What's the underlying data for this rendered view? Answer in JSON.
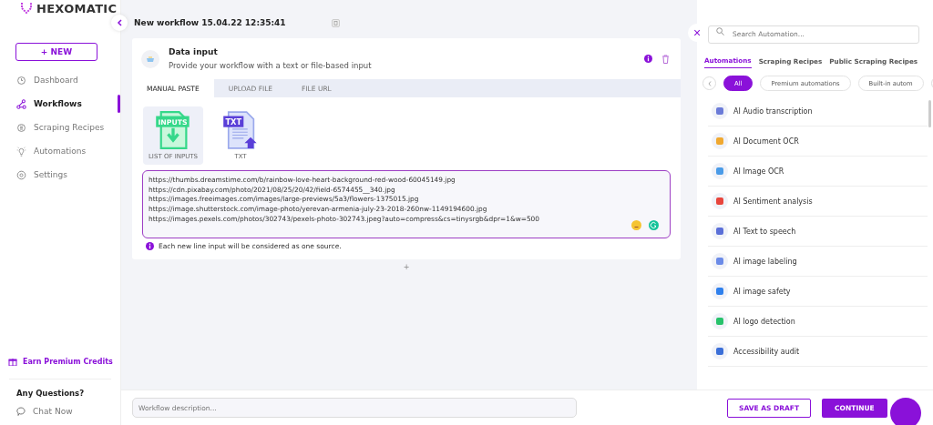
{
  "sidebar": {
    "logo": "HEXOMATIC",
    "new_button": "+ NEW",
    "items": [
      {
        "label": "Dashboard",
        "selected": false
      },
      {
        "label": "Workflows",
        "selected": true
      },
      {
        "label": "Scraping Recipes",
        "selected": false
      },
      {
        "label": "Automations",
        "selected": false
      },
      {
        "label": "Settings",
        "selected": false
      }
    ],
    "earn_credits": "Earn Premium Credits",
    "questions_title": "Any Questions?",
    "chat_now": "Chat Now"
  },
  "workflow": {
    "title": "New workflow 15.04.22 12:35:41",
    "card": {
      "title": "Data input",
      "description": "Provide your workflow with a text or file-based input",
      "tabs": [
        {
          "label": "MANUAL PASTE",
          "selected": true
        },
        {
          "label": "UPLOAD FILE",
          "selected": false
        },
        {
          "label": "FILE URL",
          "selected": false
        }
      ],
      "sources": [
        {
          "label": "LIST OF INPUTS",
          "badge": "INPUTS",
          "selected": true
        },
        {
          "label": "TXT",
          "badge": "TXT",
          "selected": false
        }
      ],
      "input_lines": [
        "https://thumbs.dreamstime.com/b/rainbow-love-heart-background-red-wood-60045149.jpg",
        "https://cdn.pixabay.com/photo/2021/08/25/20/42/field-6574455__340.jpg",
        "https://images.freeimages.com/images/large-previews/5a3/flowers-1375015.jpg",
        "https://image.shutterstock.com/image-photo/yerevan-armenia-july-23-2018-260nw-1149194600.jpg",
        "https://images.pexels.com/photos/302743/pexels-photo-302743.jpeg?auto=compress&cs=tinysrgb&dpr=1&w=500"
      ],
      "hint": "Each new line input will be considered as one source."
    },
    "add_step": "+"
  },
  "automation_panel": {
    "close": "×",
    "search_placeholder": "Search Automation...",
    "tabs": [
      {
        "label": "Automations",
        "selected": true
      },
      {
        "label": "Scraping Recipes",
        "selected": false
      },
      {
        "label": "Public Scraping Recipes",
        "selected": false
      }
    ],
    "filters": [
      {
        "label": "All",
        "selected": true
      },
      {
        "label": "Premium automations",
        "selected": false
      },
      {
        "label": "Built-in autom",
        "selected": false
      }
    ],
    "items": [
      {
        "label": "AI Audio transcription",
        "color": "#6b7bd8"
      },
      {
        "label": "AI Document OCR",
        "color": "#f0a830"
      },
      {
        "label": "AI Image OCR",
        "color": "#4a9be8"
      },
      {
        "label": "AI Sentiment analysis",
        "color": "#e8453c"
      },
      {
        "label": "AI Text to speech",
        "color": "#5a6fd8"
      },
      {
        "label": "AI image labeling",
        "color": "#6b8be8"
      },
      {
        "label": "AI image safety",
        "color": "#2f80ed"
      },
      {
        "label": "AI logo detection",
        "color": "#27c26b"
      },
      {
        "label": "Accessibility audit",
        "color": "#3b6fd8"
      }
    ]
  },
  "footer": {
    "description_placeholder": "Workflow description...",
    "save_draft": "SAVE AS DRAFT",
    "continue": "CONTINUE"
  }
}
